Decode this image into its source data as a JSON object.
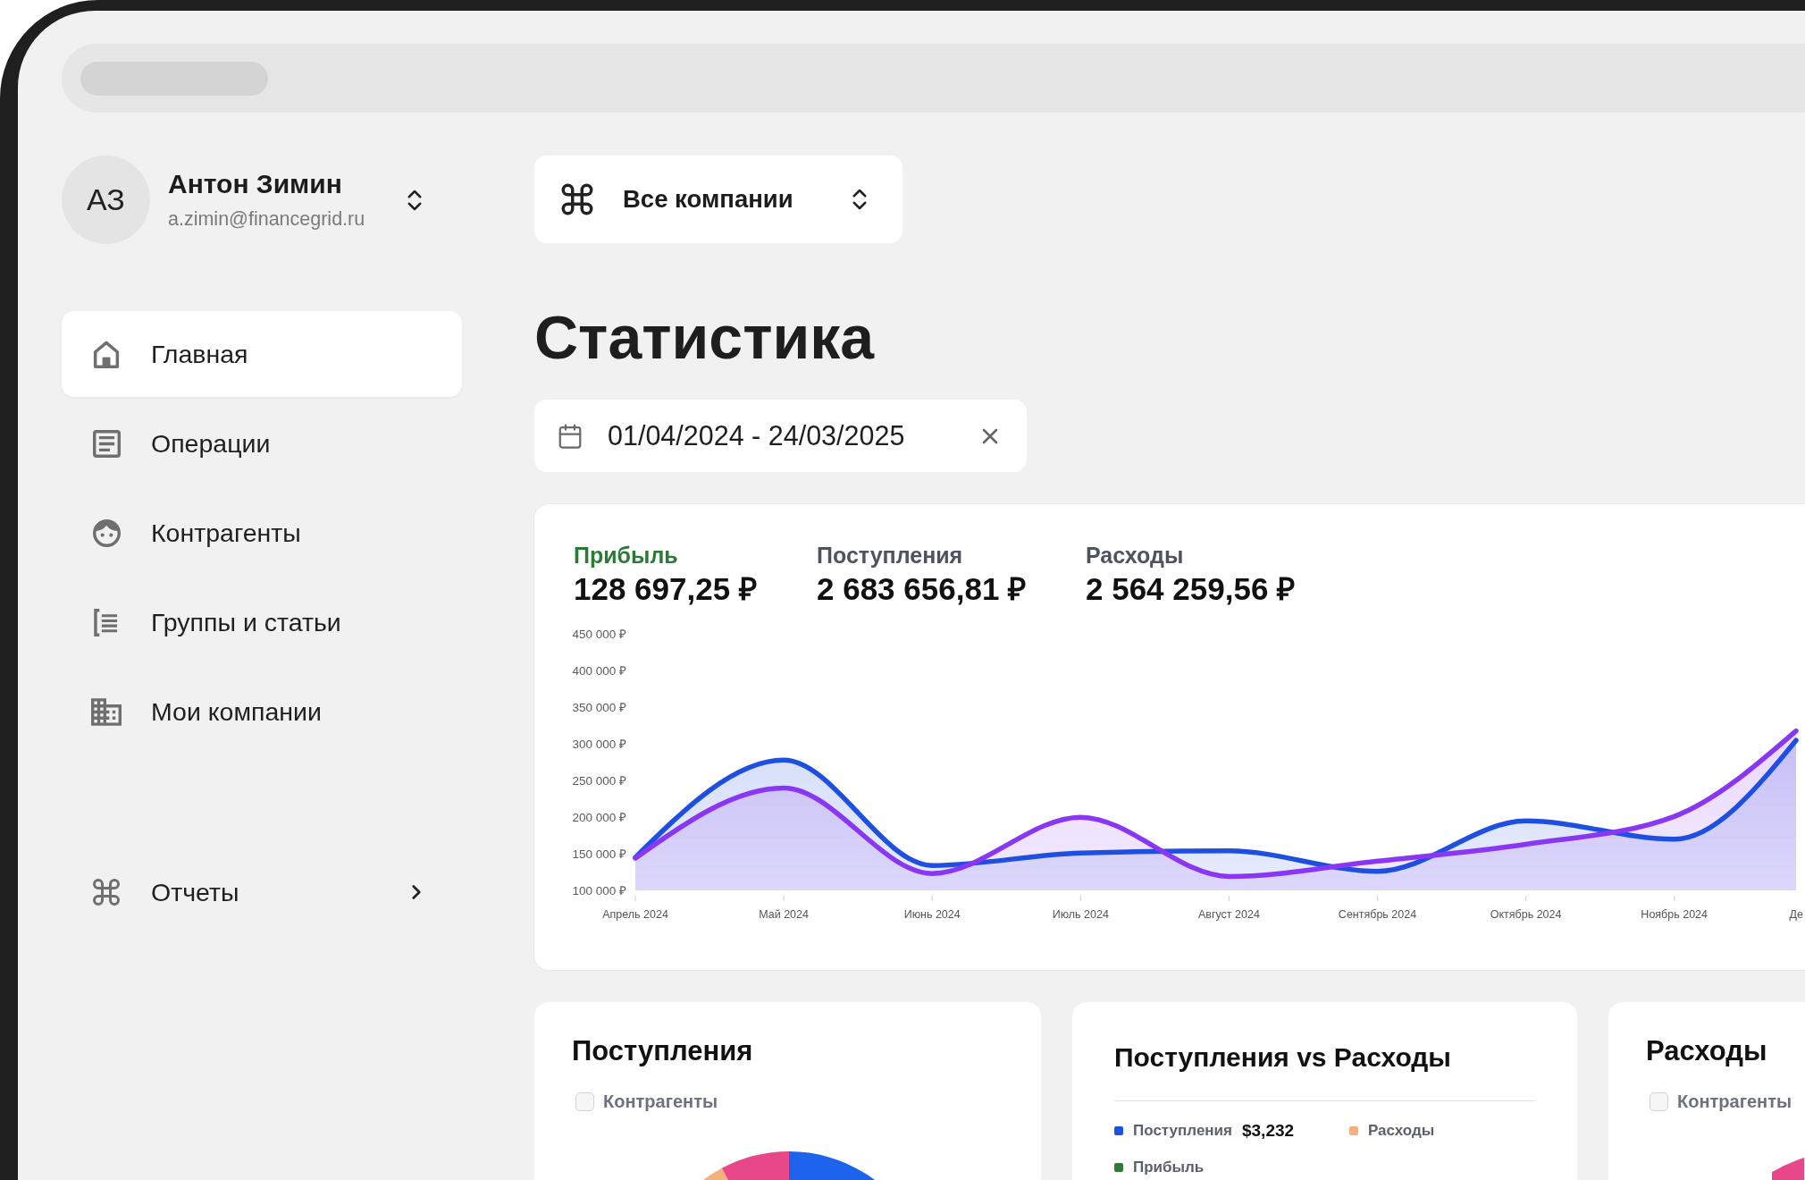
{
  "user": {
    "initials": "АЗ",
    "name": "Антон Зимин",
    "email": "a.zimin@financegrid.ru"
  },
  "nav": [
    {
      "label": "Главная",
      "selected": true
    },
    {
      "label": "Операции",
      "selected": false
    },
    {
      "label": "Контрагенты",
      "selected": false
    },
    {
      "label": "Группы и статьи",
      "selected": false
    },
    {
      "label": "Мои компании",
      "selected": false
    }
  ],
  "reports": {
    "label": "Отчеты",
    "expanded": false
  },
  "company_selector": {
    "value": "Все компании"
  },
  "page_title": "Статистика",
  "date_range": {
    "value": "01/04/2024 - 24/03/2025"
  },
  "stats_card": {
    "summary": [
      {
        "label": "Прибыль",
        "value": "128 697,25 ₽",
        "color": "#2b7a35"
      },
      {
        "label": "Поступления",
        "value": "2 683 656,81 ₽",
        "color": "#4d5361"
      },
      {
        "label": "Расходы",
        "value": "2 564 259,56 ₽",
        "color": "#4d5361"
      }
    ],
    "chart_data": {
      "type": "area",
      "categories": [
        "Апрель 2024",
        "Май 2024",
        "Июнь 2024",
        "Июль 2024",
        "Август 2024",
        "Сентябрь 2024",
        "Октябрь 2024",
        "Ноябрь 2024",
        "Де"
      ],
      "series": [
        {
          "color": "#1f4fe0",
          "values": [
            145000,
            278000,
            134000,
            151000,
            154000,
            126000,
            195000,
            170000,
            305000
          ]
        },
        {
          "color": "#8a36f5",
          "values": [
            144000,
            240000,
            123000,
            200000,
            119000,
            140000,
            163000,
            201000,
            318000
          ]
        }
      ],
      "ylim": [
        100000,
        450000
      ],
      "yticks": [
        {
          "value": 450000,
          "label": "450 000 ₽"
        },
        {
          "value": 400000,
          "label": "400 000 ₽"
        },
        {
          "value": 350000,
          "label": "350 000 ₽"
        },
        {
          "value": 300000,
          "label": "300 000 ₽"
        },
        {
          "value": 250000,
          "label": "250 000 ₽"
        },
        {
          "value": 200000,
          "label": "200 000 ₽"
        },
        {
          "value": 150000,
          "label": "150 000 ₽"
        },
        {
          "value": 100000,
          "label": "100 000 ₽"
        }
      ]
    }
  },
  "cards": [
    {
      "kind": "donut",
      "title": "Поступления",
      "filter": {
        "label": "Контрагенты",
        "checked": false
      }
    },
    {
      "kind": "legend",
      "title": "Поступления vs Расходы",
      "legend": [
        {
          "label": "Поступления",
          "value": "$3,232",
          "color": "#1a56db"
        },
        {
          "label": "Расходы",
          "color": "#f8b07f"
        },
        {
          "label": "Прибыль",
          "color": "#2f7d3a"
        }
      ]
    },
    {
      "kind": "donut",
      "title": "Расходы",
      "filter": {
        "label": "Контрагенты",
        "checked": false
      }
    }
  ]
}
